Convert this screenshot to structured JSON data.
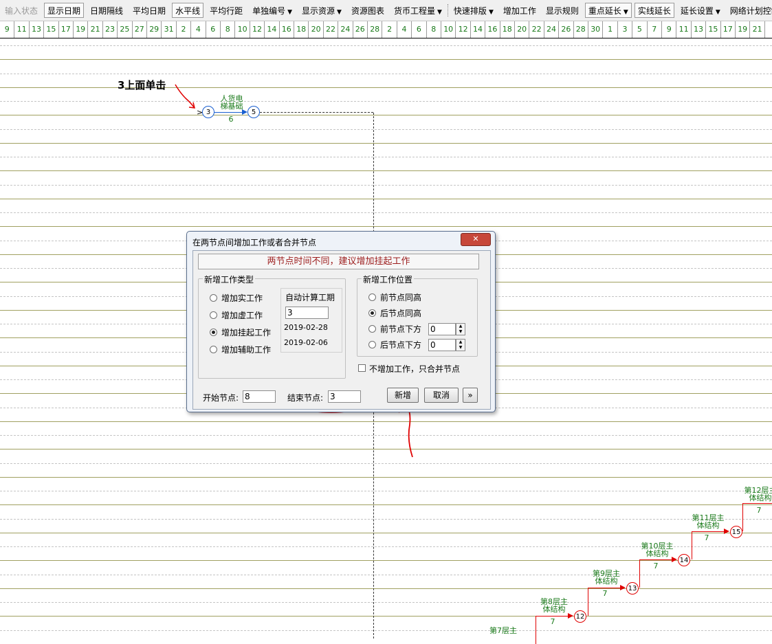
{
  "toolbar": {
    "items": [
      {
        "label": "输入状态",
        "state": "disabled",
        "drop": false
      },
      {
        "label": "显示日期",
        "state": "pressed",
        "drop": false
      },
      {
        "label": "日期隔线",
        "state": "normal",
        "drop": false
      },
      {
        "label": "平均日期",
        "state": "normal",
        "drop": false
      },
      {
        "label": "水平线",
        "state": "pressed",
        "drop": false
      },
      {
        "label": "平均行距",
        "state": "normal",
        "drop": false
      },
      {
        "label": "单独编号",
        "state": "normal",
        "drop": true
      },
      {
        "label": "显示资源",
        "state": "normal",
        "drop": true
      },
      {
        "label": "资源图表",
        "state": "normal",
        "drop": false
      },
      {
        "label": "货币工程量",
        "state": "normal",
        "drop": true
      },
      {
        "label": "快速排版",
        "state": "normal",
        "drop": true,
        "grip_before": true
      },
      {
        "label": "增加工作",
        "state": "normal",
        "drop": false
      },
      {
        "label": "显示规则",
        "state": "normal",
        "drop": false
      },
      {
        "label": "重点延长",
        "state": "pressed",
        "drop": true
      },
      {
        "label": "实线延长",
        "state": "pressed",
        "drop": false
      },
      {
        "label": "延长设置",
        "state": "normal",
        "drop": true
      },
      {
        "label": "网络计划控制",
        "state": "normal",
        "drop": true
      }
    ]
  },
  "ruler": {
    "days": [
      "9",
      "11",
      "13",
      "15",
      "17",
      "19",
      "21",
      "23",
      "25",
      "27",
      "29",
      "31",
      "2",
      "4",
      "6",
      "8",
      "10",
      "12",
      "14",
      "16",
      "18",
      "20",
      "22",
      "24",
      "26",
      "28",
      "2",
      "4",
      "6",
      "8",
      "10",
      "12",
      "14",
      "16",
      "18",
      "20",
      "22",
      "24",
      "26",
      "28",
      "30",
      "1",
      "3",
      "5",
      "7",
      "9",
      "11",
      "13",
      "15",
      "17",
      "19",
      "21"
    ],
    "color_note": "green digits"
  },
  "network": {
    "annotation_text": "3上面单击",
    "top_activity": {
      "name_line1": "人货电",
      "name_line2": "梯基础",
      "duration": "6",
      "from_node": "3",
      "to_node": "5"
    },
    "floors": [
      {
        "name_line1": "第7层主",
        "name_line2": "",
        "duration": "",
        "node": ""
      },
      {
        "name_line1": "第8层主",
        "name_line2": "体结构",
        "duration": "7",
        "node": "12"
      },
      {
        "name_line1": "第9层主",
        "name_line2": "体结构",
        "duration": "7",
        "node": "13"
      },
      {
        "name_line1": "第10层主",
        "name_line2": "体结构",
        "duration": "7",
        "node": "14"
      },
      {
        "name_line1": "第11层主",
        "name_line2": "体结构",
        "duration": "7",
        "node": "15"
      },
      {
        "name_line1": "第12层主",
        "name_line2": "体结构",
        "duration": "7",
        "node": ""
      }
    ],
    "colors": {
      "critical": "#e00000",
      "normal_arrow": "#1a5fd0",
      "label": "#1a7a1a",
      "annotation": "#e00000"
    }
  },
  "dialog": {
    "title": "在两节点间增加工作或者合并节点",
    "close_label": "✕",
    "hint": "两节点时间不同，建议增加挂起工作",
    "type_group": {
      "title": "新增工作类型",
      "options": [
        {
          "label": "增加实工作",
          "selected": false
        },
        {
          "label": "增加虚工作",
          "selected": false
        },
        {
          "label": "增加挂起工作",
          "selected": true
        },
        {
          "label": "增加辅助工作",
          "selected": false
        }
      ]
    },
    "duration": {
      "label": "自动计算工期",
      "value": "3",
      "date_start": "2019-02-28",
      "date_end": "2019-02-06"
    },
    "position_group": {
      "title": "新增工作位置",
      "options": [
        {
          "label": "前节点同高",
          "selected": false
        },
        {
          "label": "后节点同高",
          "selected": true
        },
        {
          "label": "前节点下方",
          "selected": false,
          "value": "0"
        },
        {
          "label": "后节点下方",
          "selected": false,
          "value": "0"
        }
      ]
    },
    "merge_only": {
      "label": "不增加工作，只合并节点",
      "checked": false
    },
    "start_node": {
      "label": "开始节点:",
      "value": "8"
    },
    "end_node": {
      "label": "结束节点:",
      "value": "3"
    },
    "buttons": {
      "add": "新增",
      "cancel": "取消",
      "more": "»"
    }
  }
}
